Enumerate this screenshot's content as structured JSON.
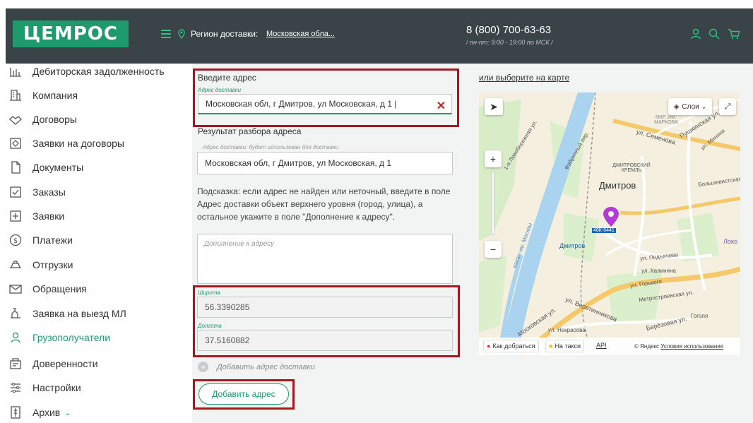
{
  "header": {
    "logo": "ЦЕМРОС",
    "region_label": "Регион доставки:",
    "region_value": "Московская обла...",
    "phone": "8 (800) 700-63-63",
    "hours": "/ пн-пт: 9:00 - 19:00 по МСК /",
    "accent": "#1f9a6c",
    "bg": "#3a4347"
  },
  "sidebar": {
    "items": [
      {
        "label": "Дебиторская задолженность",
        "icon": "bar-chart-icon"
      },
      {
        "label": "Компания",
        "icon": "building-icon"
      },
      {
        "label": "Договоры",
        "icon": "handshake-icon"
      },
      {
        "label": "Заявки на договоры",
        "icon": "contract-request-icon"
      },
      {
        "label": "Документы",
        "icon": "document-icon"
      },
      {
        "label": "Заказы",
        "icon": "order-check-icon"
      },
      {
        "label": "Заявки",
        "icon": "plus-square-icon"
      },
      {
        "label": "Платежи",
        "icon": "dollar-circle-icon"
      },
      {
        "label": "Отгрузки",
        "icon": "shipment-icon"
      },
      {
        "label": "Обращения",
        "icon": "envelope-icon"
      },
      {
        "label": "Заявка на выезд МЛ",
        "icon": "visit-request-icon"
      },
      {
        "label": "Грузополучатели",
        "icon": "recipient-icon"
      },
      {
        "label": "Доверенности",
        "icon": "power-of-attorney-icon"
      },
      {
        "label": "Настройки",
        "icon": "sliders-icon"
      },
      {
        "label": "Архив",
        "icon": "archive-icon"
      }
    ],
    "active_index": 11
  },
  "form": {
    "enter_address_title": "Введите адрес",
    "address_label": "Адрес доставки",
    "address_value": "Московская обл, г Дмитров, ул Московская, д 1",
    "parse_result_title": "Результат разбора адреса",
    "parsed_label": "Адрес доставки: будет использован для доставки",
    "parsed_value": "Московская обл, г Дмитров, ул Московская, д 1",
    "hint": "Подсказка: если адрес не найден или неточный, введите в поле Адрес доставки объект верхнего уровня (город, улица), а остальное укажите в поле \"Дополнение к адресу\".",
    "addition_placeholder": "Дополнение к адресу",
    "latitude_label": "Широта",
    "latitude_value": "56.3390285",
    "longitude_label": "Долгота",
    "longitude_value": "37.5160882",
    "add_delivery_address": "Добавить адрес доставки",
    "add_address_button": "Добавить адрес"
  },
  "map": {
    "choose_link": "или выберите на карте",
    "layers": "Слои",
    "city": "Дмитров",
    "kremlin": "ДМИТРОВСКИЙ КРЕМЛЬ",
    "district": "МКР. ИМ. МАРКОВА",
    "station": "Дмитров",
    "road": "46К-0441",
    "locality": "Локо",
    "streets": [
      "ул. Семенова",
      "Пушкинская ул.",
      "ул. Минина",
      "Большевистская",
      "ул. Калинина",
      "ул. Горького",
      "Метростроевская ул.",
      "ул. Веретенникова",
      "Московская ул.",
      "ул. Некрасова",
      "Берёзовая ул.",
      "Гоголя",
      "ул. Подъячева",
      "канал им. Москвы",
      "Фабричный пер.",
      "1-я Левобережная ул."
    ],
    "route_btn": "Как добраться",
    "taxi_btn": "На такси",
    "api_link": "API",
    "copyright": "© Яндекс",
    "terms_link": "Условия использования"
  }
}
